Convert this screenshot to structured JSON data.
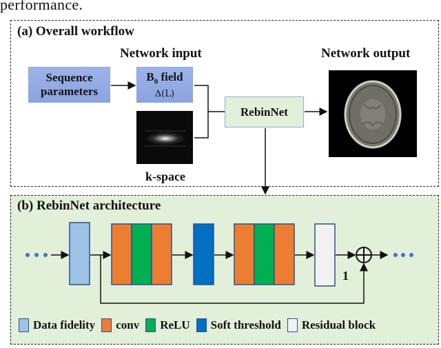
{
  "caption_fragment": "performance.",
  "panel_a": {
    "title": "(a) Overall workflow",
    "network_input_label": "Network input",
    "network_output_label": "Network output",
    "sequence_box": {
      "line1": "Sequence",
      "line2": "parameters"
    },
    "b0_box": {
      "main": "B",
      "subscript": "0",
      "suffix": " field",
      "formula": "Δ(L)"
    },
    "kspace_label": "k-space",
    "rebinnet_box": "RebinNet",
    "colors": {
      "input_box": "#8faae2",
      "rebinnet_box": "#e2efd9"
    }
  },
  "panel_b": {
    "title": "(b) RebinNet architecture",
    "residual_index_label": "1",
    "blocks": [
      {
        "type": "data-fidelity"
      },
      {
        "type": "conv-relu-conv"
      },
      {
        "type": "soft-threshold"
      },
      {
        "type": "conv-relu-conv"
      },
      {
        "type": "residual-block"
      }
    ],
    "legend": [
      {
        "label": "Data fidelity",
        "color": "#9dc3e6"
      },
      {
        "label": "conv",
        "color": "#ed7d31"
      },
      {
        "label": "ReLU",
        "color": "#00b050"
      },
      {
        "label": "Soft threshold",
        "color": "#0070c0"
      },
      {
        "label": "Residual block",
        "color": "#f2f2f2"
      }
    ],
    "background": "#e2efd9"
  }
}
